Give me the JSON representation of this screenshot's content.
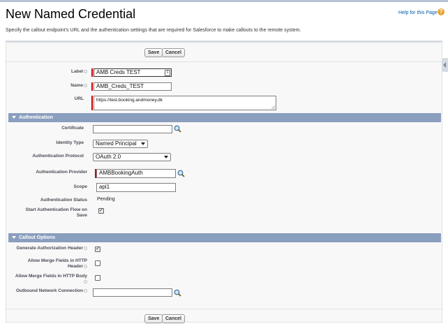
{
  "page": {
    "title": "New Named Credential",
    "help_link": "Help for this Page",
    "help_icon": "help-icon",
    "description": "Specify the callout endpoint's URL and the authentication settings that are required for Salesforce to make callouts to the remote system."
  },
  "buttons": {
    "save": "Save",
    "cancel": "Cancel"
  },
  "fields": {
    "label": {
      "label": "Label",
      "value": "AMB Creds TEST"
    },
    "name": {
      "label": "Name",
      "value": "AMB_Creds_TEST"
    },
    "url": {
      "label": "URL",
      "value": "https://test.booking.andmoney.dk"
    }
  },
  "authentication": {
    "header": "Authentication",
    "certificate": {
      "label": "Certificate",
      "value": ""
    },
    "identity_type": {
      "label": "Identity Type",
      "value": "Named Principal"
    },
    "protocol": {
      "label": "Authentication Protocol",
      "value": "OAuth 2.0"
    },
    "provider": {
      "label": "Authentication Provider",
      "value": "AMBBookingAuth"
    },
    "scope": {
      "label": "Scope",
      "value": "api1"
    },
    "status": {
      "label": "Authentication Status",
      "value": "Pending"
    },
    "start_flow": {
      "label": "Start Authentication Flow on Save",
      "checked": true,
      "mark": "✓"
    }
  },
  "callout": {
    "header": "Callout Options",
    "generate_auth_header": {
      "label": "Generate Authorization Header",
      "checked": true,
      "mark": "✓"
    },
    "merge_header": {
      "label": "Allow Merge Fields in HTTP Header",
      "checked": false
    },
    "merge_body": {
      "label": "Allow Merge Fields in HTTP Body",
      "checked": false
    },
    "outbound": {
      "label": "Outbound Network Connection",
      "value": ""
    }
  },
  "colors": {
    "section_header": "#8a9ebe",
    "required": "#cc0000",
    "link": "#015ba7"
  }
}
